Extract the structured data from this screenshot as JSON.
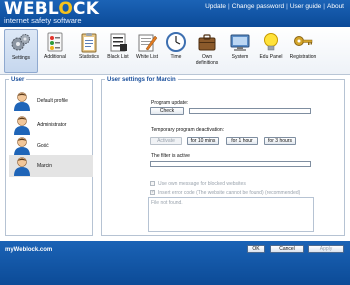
{
  "header": {
    "logo": {
      "part1": "WEBL",
      "o": "O",
      "part2": "CK",
      "subtitle": "internet safety software"
    },
    "nav": [
      "Update",
      "Change password",
      "User guide",
      "About"
    ]
  },
  "toolbar": [
    {
      "label": "Settings",
      "icon": "gears-icon",
      "active": true
    },
    {
      "label": "Additional",
      "icon": "options-icon"
    },
    {
      "label": "Statistics",
      "icon": "clipboard-icon"
    },
    {
      "label": "Black List",
      "icon": "black-list-icon"
    },
    {
      "label": "White List",
      "icon": "white-list-icon"
    },
    {
      "label": "Time",
      "icon": "clock-icon"
    },
    {
      "label": "Own definitions",
      "icon": "briefcase-icon"
    },
    {
      "label": "System",
      "icon": "system-icon"
    },
    {
      "label": "Edu Panel",
      "icon": "lightbulb-icon"
    },
    {
      "label": "Registration",
      "icon": "key-icon"
    }
  ],
  "users_panel": {
    "title": "User",
    "users": [
      "Default profile",
      "Administrator",
      "Gość",
      "Marcin"
    ],
    "selected": "Marcin"
  },
  "settings_panel": {
    "title": "User settings for Marcin",
    "program_update_label": "Program update:",
    "check_button": "Check",
    "temp_deactivation_label": "Temporary program deactivation:",
    "activate_button": "Activate",
    "for_10_mins": "for 10 mins",
    "for_1_hour": "for 1 hour",
    "for_3_hours": "for 3 hours",
    "filter_status": "The filter is active",
    "own_message_label": "Use own message for blocked websites",
    "insert_error_label": "Insert error code (The website cannot be found) (recommended)",
    "textarea_placeholder": "File not found."
  },
  "footer": {
    "brand": "myWeblock.com",
    "ok": "OK",
    "cancel": "Cancel",
    "apply": "Apply"
  },
  "colors": {
    "header_blue": "#1b63b6",
    "accent_title": "#1a4f9c"
  }
}
